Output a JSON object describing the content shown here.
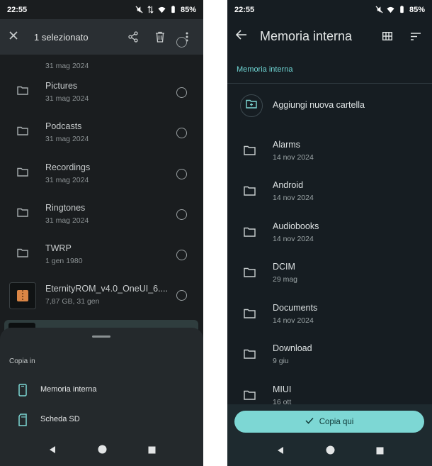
{
  "left": {
    "status": {
      "time": "22:55",
      "battery": "85%"
    },
    "appbar": {
      "title": "1 selezionato"
    },
    "partial_item": {
      "date": "31 mag 2024"
    },
    "items": [
      {
        "name": "Pictures",
        "date": "31 mag 2024",
        "icon": "folder"
      },
      {
        "name": "Podcasts",
        "date": "31 mag 2024",
        "icon": "folder"
      },
      {
        "name": "Recordings",
        "date": "31 mag 2024",
        "icon": "folder"
      },
      {
        "name": "Ringtones",
        "date": "31 mag 2024",
        "icon": "folder"
      },
      {
        "name": "TWRP",
        "date": "1 gen 1980",
        "icon": "folder"
      },
      {
        "name": "EternityROM_v4.0_OneUI_6....",
        "date": "7,87 GB, 31 gen",
        "icon": "archive"
      }
    ],
    "sheet": {
      "title": "Copia in",
      "options": [
        {
          "label": "Memoria interna",
          "icon": "phone-icon"
        },
        {
          "label": "Scheda SD",
          "icon": "sd-card-icon"
        }
      ]
    }
  },
  "right": {
    "status": {
      "time": "22:55",
      "battery": "85%"
    },
    "appbar": {
      "title": "Memoria interna"
    },
    "breadcrumb": "Memoria interna",
    "add_folder_label": "Aggiungi nuova cartella",
    "folders": [
      {
        "name": "Alarms",
        "date": "14 nov 2024"
      },
      {
        "name": "Android",
        "date": "14 nov 2024"
      },
      {
        "name": "Audiobooks",
        "date": "14 nov 2024"
      },
      {
        "name": "DCIM",
        "date": "29 mag"
      },
      {
        "name": "Documents",
        "date": "14 nov 2024"
      },
      {
        "name": "Download",
        "date": "9 giu"
      },
      {
        "name": "MIUI",
        "date": "16 ott"
      }
    ],
    "copy_button": "Copia qui"
  },
  "colors": {
    "accent": "#7dd7d4",
    "breadcrumb": "#6fd6d4"
  }
}
